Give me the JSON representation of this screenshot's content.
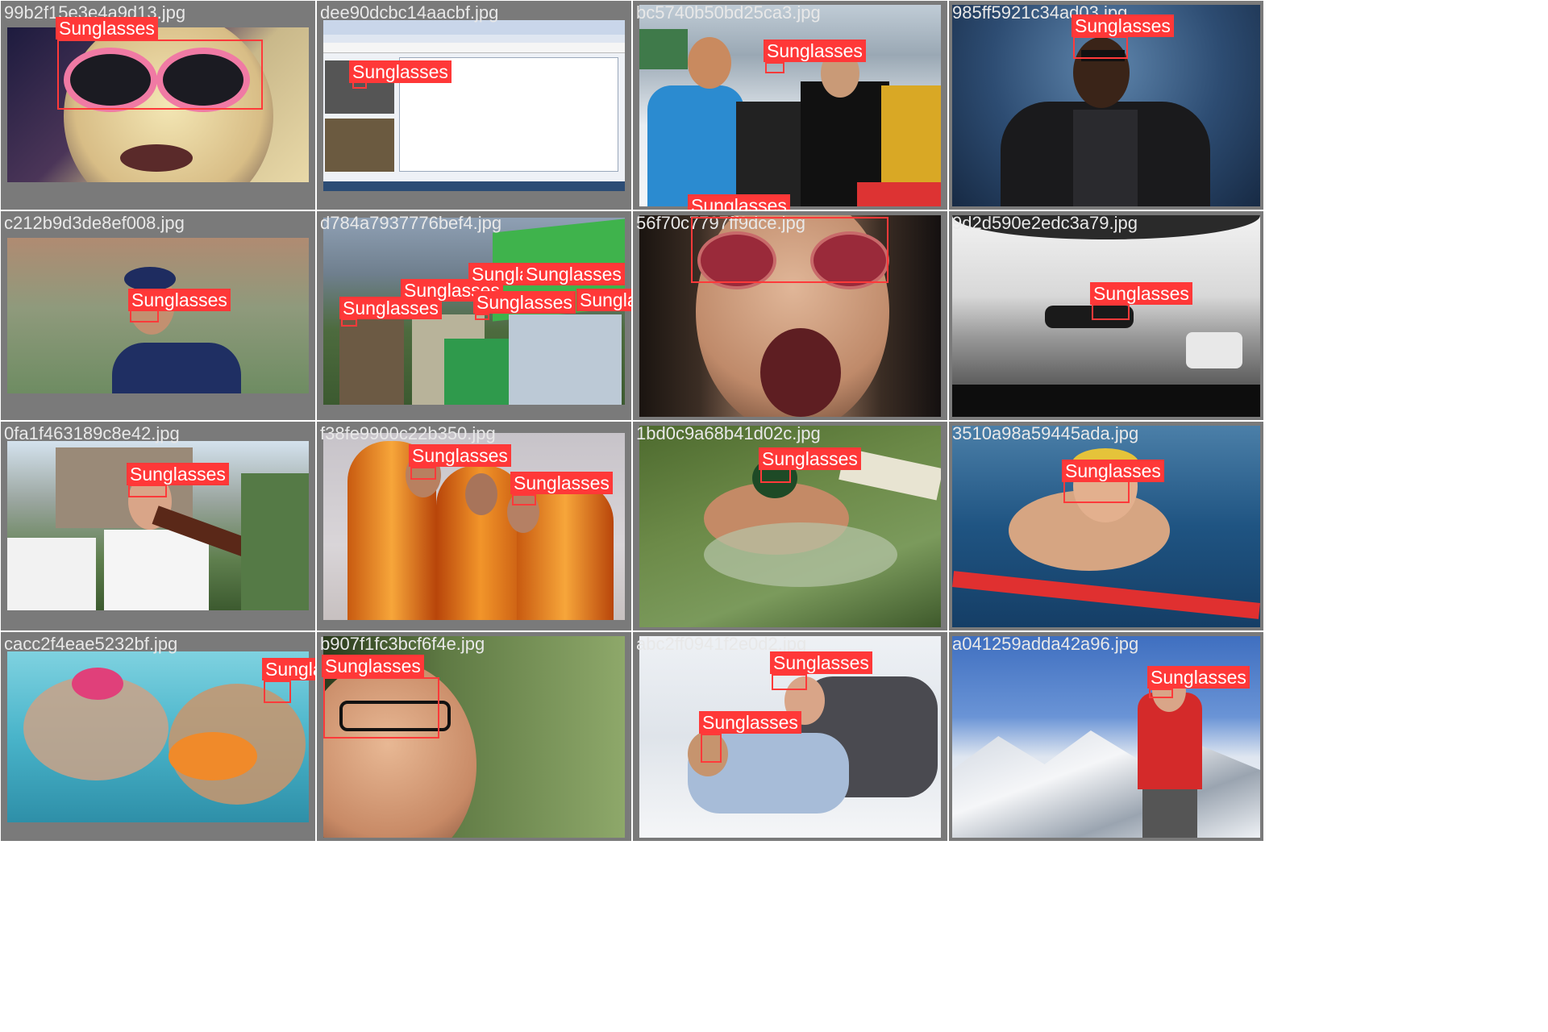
{
  "grid": {
    "class_label": "Sunglasses",
    "tiles": [
      {
        "filename": "99b2f15e3e4a9d13.jpg",
        "detections": 1
      },
      {
        "filename": "dee90dcbc14aacbf.jpg",
        "detections": 1
      },
      {
        "filename": "bc5740b50bd25ca3.jpg",
        "detections": 2
      },
      {
        "filename": "985ff5921c34ad03.jpg",
        "detections": 1
      },
      {
        "filename": "c212b9d3de8ef008.jpg",
        "detections": 1
      },
      {
        "filename": "d784a7937776bef4.jpg",
        "detections": 6
      },
      {
        "filename": "56f70c7797ff9dce.jpg",
        "detections": 1
      },
      {
        "filename": "9d2d590e2edc3a79.jpg",
        "detections": 1
      },
      {
        "filename": "0fa1f463189c8e42.jpg",
        "detections": 1
      },
      {
        "filename": "f38fe9900c22b350.jpg",
        "detections": 2
      },
      {
        "filename": "1bd0c9a68b41d02c.jpg",
        "detections": 1
      },
      {
        "filename": "3510a98a59445ada.jpg",
        "detections": 1
      },
      {
        "filename": "cacc2f4eae5232bf.jpg",
        "detections": 1
      },
      {
        "filename": "b907f1fc3bcf6f4e.jpg",
        "detections": 1
      },
      {
        "filename": "abc2ff0941f2e0d2.jpg",
        "detections": 2
      },
      {
        "filename": "a041259adda42a96.jpg",
        "detections": 1
      }
    ]
  },
  "colors": {
    "box": "#ff3a3a",
    "label_bg": "#ff3838",
    "label_text": "#ffffff",
    "tile_border": "#7a7a7a",
    "filename_text": "#e8e8e8"
  }
}
